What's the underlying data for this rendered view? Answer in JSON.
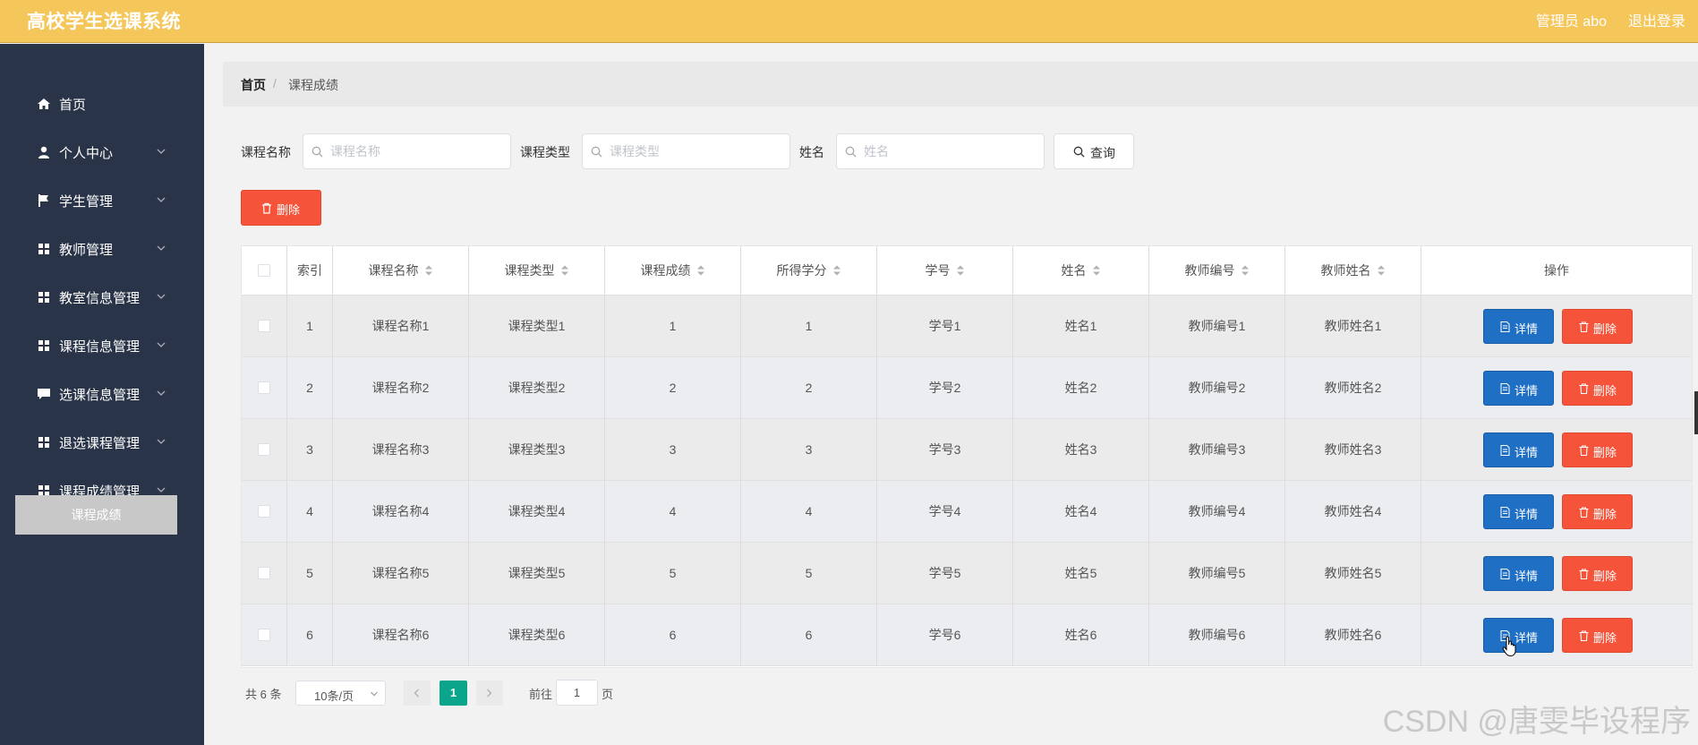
{
  "app": {
    "title": "高校学生选课系统",
    "user": "管理员 abo",
    "logout": "退出登录"
  },
  "sidebar": {
    "items": [
      {
        "label": "首页",
        "icon": "home-icon"
      },
      {
        "label": "个人中心",
        "icon": "user-icon"
      },
      {
        "label": "学生管理",
        "icon": "flag-icon"
      },
      {
        "label": "教师管理",
        "icon": "grid-icon"
      },
      {
        "label": "教室信息管理",
        "icon": "grid-icon"
      },
      {
        "label": "课程信息管理",
        "icon": "grid-icon"
      },
      {
        "label": "选课信息管理",
        "icon": "chat-icon"
      },
      {
        "label": "退选课程管理",
        "icon": "grid-icon"
      },
      {
        "label": "课程成绩管理",
        "icon": "grid-icon"
      }
    ],
    "active_sub": "课程成绩"
  },
  "breadcrumb": {
    "home": "首页",
    "separator": "/",
    "current": "课程成绩"
  },
  "search": {
    "course_name": {
      "label": "课程名称",
      "placeholder": "课程名称"
    },
    "course_type": {
      "label": "课程类型",
      "placeholder": "课程类型"
    },
    "name": {
      "label": "姓名",
      "placeholder": "姓名"
    },
    "query_button": "查询"
  },
  "toolbar": {
    "delete_label": "删除"
  },
  "table": {
    "columns": [
      "索引",
      "课程名称",
      "课程类型",
      "课程成绩",
      "所得学分",
      "学号",
      "姓名",
      "教师编号",
      "教师姓名",
      "操作"
    ],
    "rows": [
      [
        "1",
        "课程名称1",
        "课程类型1",
        "1",
        "1",
        "学号1",
        "姓名1",
        "教师编号1",
        "教师姓名1"
      ],
      [
        "2",
        "课程名称2",
        "课程类型2",
        "2",
        "2",
        "学号2",
        "姓名2",
        "教师编号2",
        "教师姓名2"
      ],
      [
        "3",
        "课程名称3",
        "课程类型3",
        "3",
        "3",
        "学号3",
        "姓名3",
        "教师编号3",
        "教师姓名3"
      ],
      [
        "4",
        "课程名称4",
        "课程类型4",
        "4",
        "4",
        "学号4",
        "姓名4",
        "教师编号4",
        "教师姓名4"
      ],
      [
        "5",
        "课程名称5",
        "课程类型5",
        "5",
        "5",
        "学号5",
        "姓名5",
        "教师编号5",
        "教师姓名5"
      ],
      [
        "6",
        "课程名称6",
        "课程类型6",
        "6",
        "6",
        "学号6",
        "姓名6",
        "教师编号6",
        "教师姓名6"
      ]
    ],
    "detail_label": "详情",
    "delete_label": "删除"
  },
  "pagination": {
    "total": "共 6 条",
    "page_size": "10条/页",
    "current": "1",
    "goto_label": "前往",
    "goto_value": "1",
    "page_suffix": "页"
  },
  "watermark": "CSDN @唐雯毕设程序",
  "colors": {
    "header": "#f5c65a",
    "sidebar": "#2a3448",
    "primary": "#1f6fc4",
    "danger": "#f5543a",
    "pager_active": "#0aa58a"
  }
}
